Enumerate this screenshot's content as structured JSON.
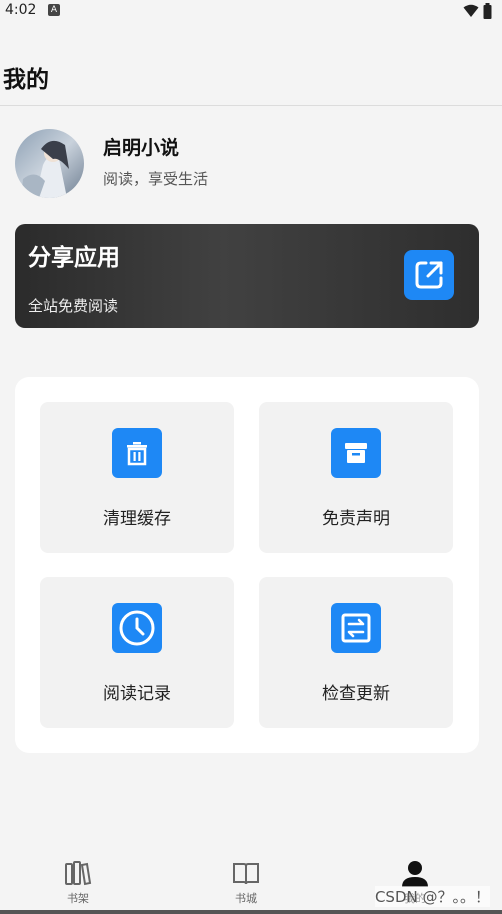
{
  "status_bar": {
    "time": "4:02",
    "notification_badge": "A"
  },
  "header": {
    "title": "我的"
  },
  "profile": {
    "name": "启明小说",
    "subtitle": "阅读，享受生活"
  },
  "share_card": {
    "title": "分享应用",
    "subtitle": "全站免费阅读",
    "icon": "external-link-icon"
  },
  "grid": {
    "items": [
      {
        "label": "清理缓存",
        "icon": "trash-icon"
      },
      {
        "label": "免责声明",
        "icon": "archive-icon"
      },
      {
        "label": "阅读记录",
        "icon": "clock-icon"
      },
      {
        "label": "检查更新",
        "icon": "update-arrows-icon"
      }
    ]
  },
  "bottom_nav": {
    "items": [
      {
        "label": "书架",
        "icon": "bookshelf-icon"
      },
      {
        "label": "书城",
        "icon": "book-open-icon"
      },
      {
        "label": "我的",
        "icon": "person-icon",
        "active": true
      }
    ]
  },
  "watermark": "CSDN @？。。！",
  "colors": {
    "accent": "#1e88f5",
    "background": "#f4f4f4",
    "card_dark": "#333333"
  }
}
